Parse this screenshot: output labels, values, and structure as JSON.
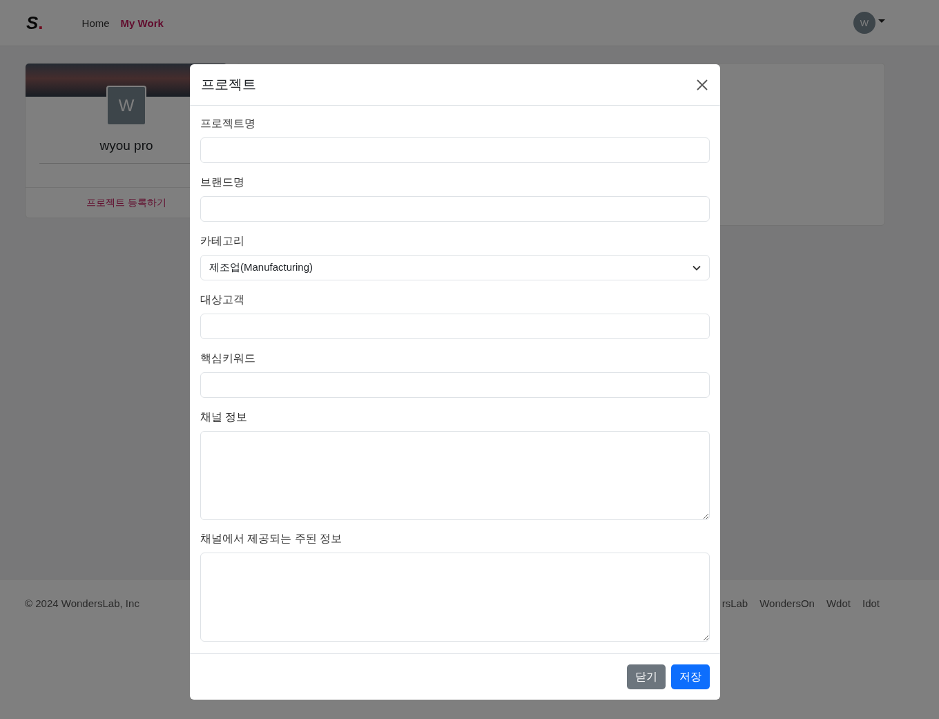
{
  "navbar": {
    "logo_letter": "S",
    "logo_dot": ".",
    "links": [
      {
        "label": "Home",
        "selected": false
      },
      {
        "label": "My Work",
        "selected": true
      }
    ],
    "avatar": "W"
  },
  "profile_card": {
    "avatar": "W",
    "name": "wyou pro",
    "link": "프로젝트 등록하기"
  },
  "footer": {
    "copyright": "© 2024 WondersLab, Inc",
    "links": [
      "rsLab",
      "WondersOn",
      "Wdot",
      "Idot"
    ]
  },
  "modal": {
    "title": "프로젝트",
    "fields": [
      {
        "kind": "input",
        "label": "프로젝트명"
      },
      {
        "kind": "input",
        "label": "브랜드명"
      },
      {
        "kind": "select",
        "label": "카테고리",
        "value": "제조업(Manufacturing)"
      },
      {
        "kind": "input",
        "label": "대상고객"
      },
      {
        "kind": "input",
        "label": "핵심키워드"
      },
      {
        "kind": "textarea",
        "label": "채널 정보"
      },
      {
        "kind": "textarea",
        "label": "채널에서 제공되는 주된 정보"
      }
    ],
    "buttons": [
      {
        "label": "닫기",
        "kind": "secondary"
      },
      {
        "label": "저장",
        "kind": "primary"
      }
    ]
  }
}
